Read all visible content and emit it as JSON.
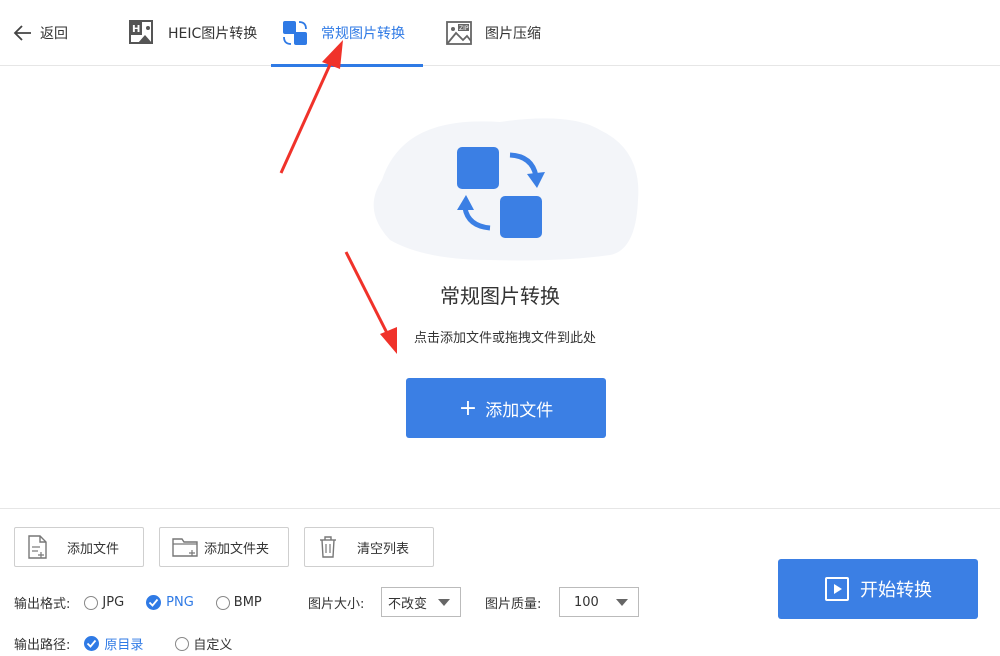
{
  "header": {
    "back_label": "返回",
    "tabs": [
      {
        "label": "HEIC图片转换",
        "active": false
      },
      {
        "label": "常规图片转换",
        "active": true
      },
      {
        "label": "图片压缩",
        "active": false
      }
    ]
  },
  "drop": {
    "title": "常规图片转换",
    "hint": "点击添加文件或拖拽文件到此处",
    "add_button": "添加文件"
  },
  "toolbar": {
    "add_file": "添加文件",
    "add_folder": "添加文件夹",
    "clear_list": "清空列表"
  },
  "options": {
    "format_label": "输出格式:",
    "formats": [
      {
        "label": "JPG",
        "selected": false
      },
      {
        "label": "PNG",
        "selected": true
      },
      {
        "label": "BMP",
        "selected": false
      }
    ],
    "size_label": "图片大小:",
    "size_value": "不改变",
    "quality_label": "图片质量:",
    "quality_value": "100",
    "path_label": "输出路径:",
    "paths": [
      {
        "label": "原目录",
        "selected": true
      },
      {
        "label": "自定义",
        "selected": false
      }
    ]
  },
  "start_button": "开始转换",
  "colors": {
    "accent": "#2f7ae5",
    "arrow": "#f0322a",
    "blob": "#f3f5f9"
  },
  "icons": {
    "back": "arrow-left-icon",
    "heic": "heic-image-icon",
    "convert": "convert-squares-icon",
    "compress": "zip-image-icon",
    "file": "file-add-icon",
    "folder": "folder-add-icon",
    "trash": "trash-icon",
    "play": "play-icon"
  }
}
